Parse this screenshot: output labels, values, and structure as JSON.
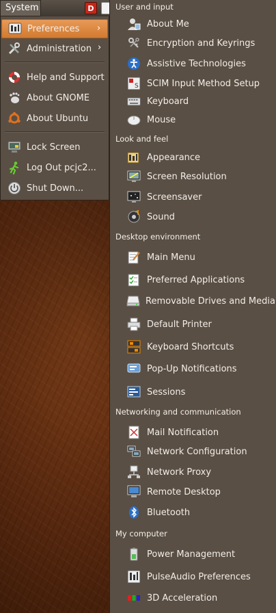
{
  "panel": {
    "system_label": "System",
    "launcher_d_letter": "D"
  },
  "system_menu": {
    "items": [
      {
        "label": "Preferences",
        "icon": "preferences-icon",
        "active": true
      },
      {
        "label": "Administration",
        "icon": "administration-icon"
      },
      {
        "label": "Help and Support",
        "icon": "help-lifebuoy-icon"
      },
      {
        "label": "About GNOME",
        "icon": "gnome-foot-icon"
      },
      {
        "label": "About Ubuntu",
        "icon": "ubuntu-logo-icon"
      },
      {
        "label": "Lock Screen",
        "icon": "lock-screen-icon"
      },
      {
        "label": "Log Out pcjc2...",
        "icon": "log-out-runner-icon"
      },
      {
        "label": "Shut Down...",
        "icon": "power-icon"
      }
    ]
  },
  "preferences_menu": {
    "sections": [
      {
        "header": "User and input",
        "items": [
          {
            "label": "About Me",
            "icon": "user-icon"
          },
          {
            "label": "Encryption and Keyrings",
            "icon": "keys-icon"
          },
          {
            "label": "Assistive Technologies",
            "icon": "accessibility-icon"
          },
          {
            "label": "SCIM Input Method Setup",
            "icon": "scim-icon"
          },
          {
            "label": "Keyboard",
            "icon": "keyboard-icon"
          },
          {
            "label": "Mouse",
            "icon": "mouse-icon"
          }
        ]
      },
      {
        "header": "Look and feel",
        "items": [
          {
            "label": "Appearance",
            "icon": "appearance-icon"
          },
          {
            "label": "Screen Resolution",
            "icon": "screen-resolution-icon"
          },
          {
            "label": "Screensaver",
            "icon": "screensaver-icon"
          },
          {
            "label": "Sound",
            "icon": "sound-icon"
          }
        ]
      },
      {
        "header": "Desktop environment",
        "items": [
          {
            "label": "Main Menu",
            "icon": "main-menu-icon"
          },
          {
            "label": "Preferred Applications",
            "icon": "preferred-applications-icon"
          },
          {
            "label": "Removable Drives and Media",
            "icon": "removable-drives-icon"
          },
          {
            "label": "Default Printer",
            "icon": "printer-icon"
          },
          {
            "label": "Keyboard Shortcuts",
            "icon": "keyboard-shortcuts-icon"
          },
          {
            "label": "Pop-Up Notifications",
            "icon": "notifications-icon"
          },
          {
            "label": "Sessions",
            "icon": "sessions-icon"
          }
        ]
      },
      {
        "header": "Networking and communication",
        "items": [
          {
            "label": "Mail Notification",
            "icon": "mail-notification-icon"
          },
          {
            "label": "Network Configuration",
            "icon": "network-configuration-icon"
          },
          {
            "label": "Network Proxy",
            "icon": "network-proxy-icon"
          },
          {
            "label": "Remote Desktop",
            "icon": "remote-desktop-icon"
          },
          {
            "label": "Bluetooth",
            "icon": "bluetooth-icon"
          }
        ]
      },
      {
        "header": "My computer",
        "items": [
          {
            "label": "Power Management",
            "icon": "power-management-icon"
          },
          {
            "label": "PulseAudio Preferences",
            "icon": "pulseaudio-icon"
          },
          {
            "label": "3D Acceleration",
            "icon": "3d-acceleration-icon"
          }
        ]
      }
    ]
  },
  "colors": {
    "menu_bg": "#5a4f44",
    "highlight": "#e0893f",
    "text": "#f2eee9"
  }
}
